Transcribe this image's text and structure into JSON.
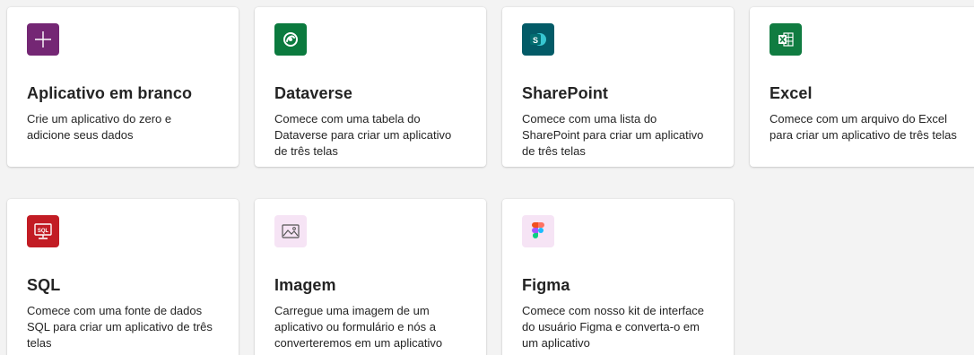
{
  "cards": [
    {
      "title": "Aplicativo em branco",
      "description": "Crie um aplicativo do zero e adicione seus dados",
      "icon": "plus-icon",
      "icon_color": "#742774"
    },
    {
      "title": "Dataverse",
      "description": "Comece com uma tabela do Dataverse para criar um aplicativo de três telas",
      "icon": "dataverse-icon",
      "icon_color": "#0b7a3e"
    },
    {
      "title": "SharePoint",
      "description": "Comece com uma lista do SharePoint para criar um aplicativo de três telas",
      "icon": "sharepoint-icon",
      "icon_color": "#035b67"
    },
    {
      "title": "Excel",
      "description": "Comece com um arquivo do Excel para criar um aplicativo de três telas",
      "icon": "excel-icon",
      "icon_color": "#107c41"
    },
    {
      "title": "SQL",
      "description": "Comece com uma fonte de dados SQL para criar um aplicativo de três telas",
      "icon": "sql-icon",
      "icon_color": "#c21c24"
    },
    {
      "title": "Imagem",
      "description": "Carregue uma imagem de um aplicativo ou formulário e nós a converteremos em um aplicativo",
      "icon": "image-icon",
      "icon_color": "#f6e4f5"
    },
    {
      "title": "Figma",
      "description": "Comece com nosso kit de interface do usuário Figma e converta-o em um aplicativo",
      "icon": "figma-icon",
      "icon_color": "#f6e4f5"
    }
  ]
}
